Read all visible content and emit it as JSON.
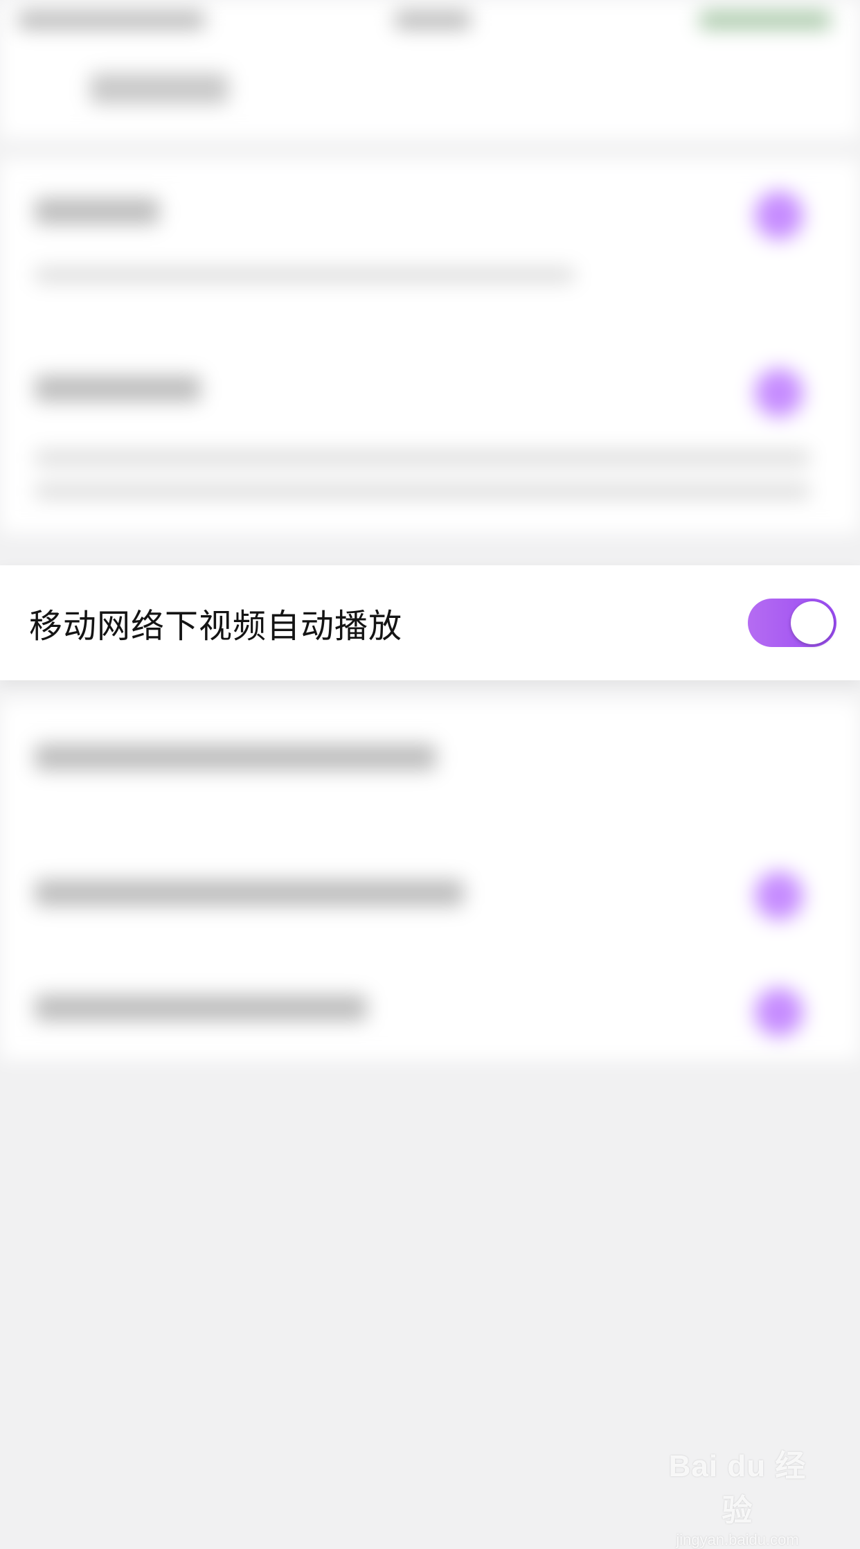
{
  "setting": {
    "label": "移动网络下视频自动播放",
    "enabled": true,
    "accent": "#a25af3"
  },
  "watermark": {
    "brand": "Bai du 经验",
    "url": "jingyan.baidu.com"
  }
}
